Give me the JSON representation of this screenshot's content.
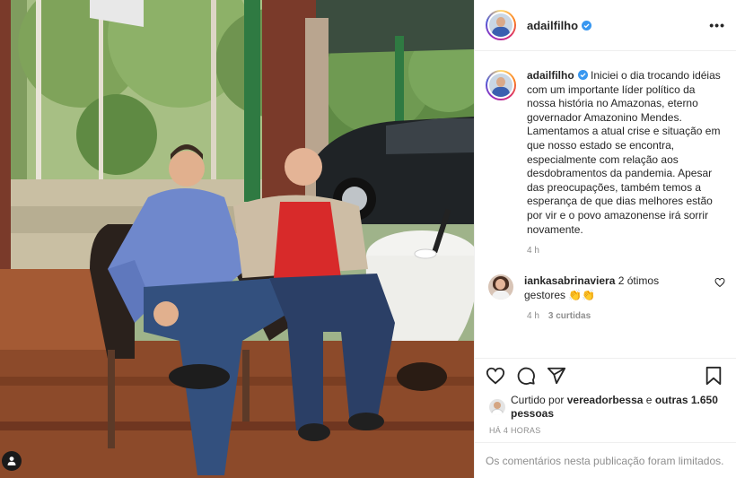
{
  "post": {
    "author": "adailfilho",
    "verified": true,
    "more_label": "•••",
    "caption": "Iniciei o dia trocando idéias com um importante líder político da nossa história no Amazonas, eterno governador Amazonino Mendes. Lamentamos a atual crise e situação em que nosso estado se encontra, especialmente com relação aos desdobramentos da pandemia. Apesar das preocupações, também temos a esperança de que dias melhores estão por vir e o povo amazonense irá sorrir novamente.",
    "caption_time": "4 h"
  },
  "comments": [
    {
      "username": "iankasabrinaviera",
      "text": "2 ótimos gestores 👏👏",
      "time": "4 h",
      "likes": "3 curtidas"
    }
  ],
  "likes": {
    "prefix": "Curtido por",
    "user": "vereadorbessa",
    "connector": "e",
    "others": "outras 1.650 pessoas"
  },
  "timestamp": "HÁ 4 HORAS",
  "comments_limited": "Os comentários nesta publicação foram limitados.",
  "icons": {
    "like": "heart-icon",
    "comment": "comment-icon",
    "share": "share-icon",
    "save": "bookmark-icon",
    "tag": "user-tag-icon"
  },
  "colors": {
    "verified": "#3897f0",
    "text": "#262626",
    "muted": "#8e8e8e",
    "border": "#efefef"
  }
}
